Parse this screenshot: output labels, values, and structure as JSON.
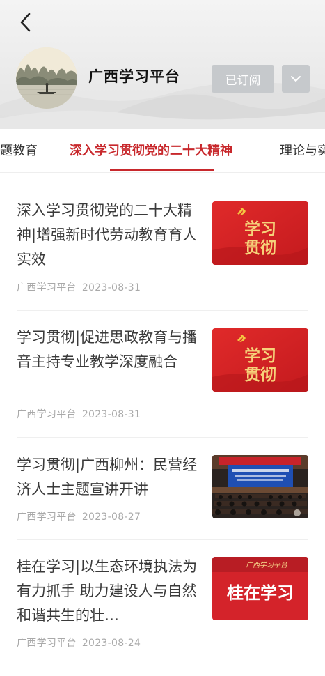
{
  "header": {
    "channel_name": "广西学习平台",
    "subscribed_label": "已订阅"
  },
  "tabs": [
    {
      "label": "主题教育",
      "active": false
    },
    {
      "label": "深入学习贯彻党的二十大精神",
      "active": true
    },
    {
      "label": "理论与实践",
      "active": false
    }
  ],
  "articles": [
    {
      "title": "深入学习贯彻党的二十大精神|增强新时代劳动教育育人实效",
      "source": "广西学习平台",
      "date": "2023-08-31",
      "thumb_text": [
        "学习",
        "贯彻"
      ]
    },
    {
      "title": "学习贯彻|促进思政教育与播音主持专业教学深度融合",
      "source": "广西学习平台",
      "date": "2023-08-31",
      "thumb_text": [
        "学习",
        "贯彻"
      ]
    },
    {
      "title": "学习贯彻|广西柳州：民营经济人士主题宣讲开讲",
      "source": "广西学习平台",
      "date": "2023-08-27"
    },
    {
      "title": "桂在学习|以生态环境执法为有力抓手 助力建设人与自然和谐共生的壮…",
      "source": "广西学习平台",
      "date": "2023-08-24",
      "thumb_text": "桂在学习",
      "thumb_logo": "广西学习平台"
    }
  ],
  "colors": {
    "accent": "#c8282c",
    "button_gray": "#c6c9cc",
    "meta_text": "#a9a9a9"
  }
}
